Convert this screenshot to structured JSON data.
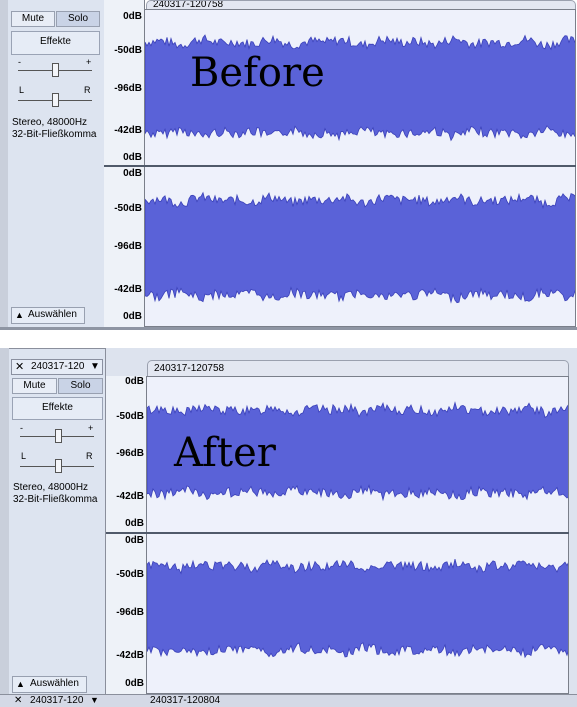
{
  "tracks": [
    {
      "id": "top",
      "clip_name": "240317-120758",
      "mute_label": "Mute",
      "solo_label": "Solo",
      "effects_label": "Effekte",
      "gain_minus": "-",
      "gain_plus": "+",
      "pan_left": "L",
      "pan_right": "R",
      "info_line1": "Stereo, 48000Hz",
      "info_line2": "32-Bit-Fließkomma",
      "select_label": "Auswählen",
      "annotation": "Before",
      "ticks_ch1": [
        "0dB",
        "-50dB",
        "-96dB",
        "-42dB",
        "0dB"
      ],
      "ticks_ch2": [
        "0dB",
        "-50dB",
        "-96dB",
        "-42dB",
        "0dB"
      ]
    },
    {
      "id": "bottom",
      "track_name": "240317-120",
      "clip_name": "240317-120758",
      "mute_label": "Mute",
      "solo_label": "Solo",
      "effects_label": "Effekte",
      "gain_minus": "-",
      "gain_plus": "+",
      "pan_left": "L",
      "pan_right": "R",
      "info_line1": "Stereo, 48000Hz",
      "info_line2": "32-Bit-Fließkomma",
      "select_label": "Auswählen",
      "annotation": "After",
      "ticks_ch1": [
        "0dB",
        "-50dB",
        "-96dB",
        "-42dB",
        "0dB"
      ],
      "ticks_ch2": [
        "0dB",
        "-50dB",
        "-96dB",
        "-42dB",
        "0dB"
      ]
    }
  ],
  "next_track": {
    "track_name": "240317-120",
    "clip_name": "240317-120804"
  },
  "colors": {
    "waveform": "#5a62d8",
    "waveform_edge": "#3a40b8",
    "waveform_bg": "#eef1fb"
  },
  "icons": {
    "close": "close-icon",
    "menu": "dropdown-arrow-icon",
    "collapse": "collapse-arrow-icon"
  }
}
